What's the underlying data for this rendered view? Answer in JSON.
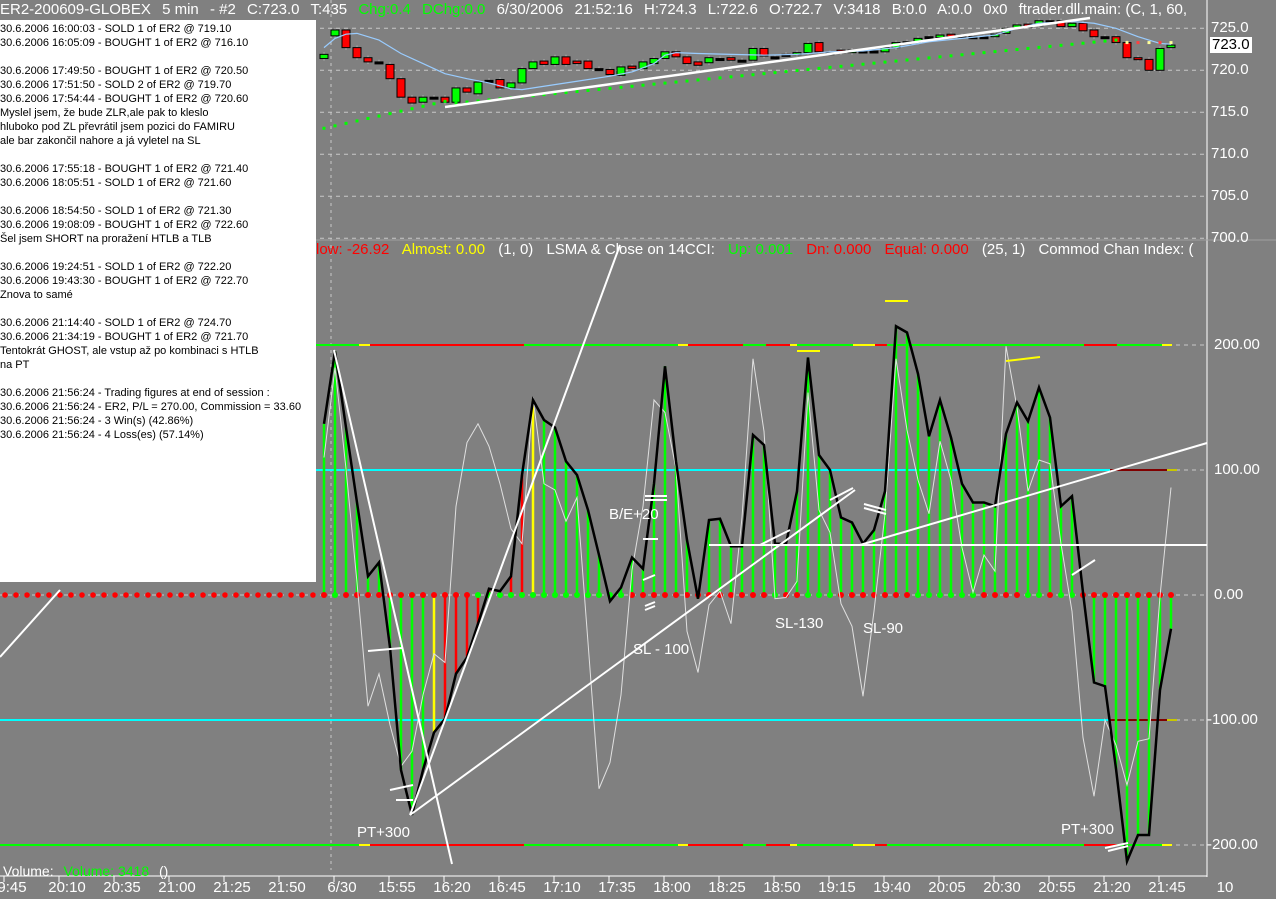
{
  "header": {
    "symbol": "ER2-200609-GLOBEX",
    "interval": "5 min",
    "chart_no": "- #2",
    "close": "C:723.0",
    "ticks": "T:435",
    "chg": "Chg:0.4",
    "dchg": "DChg:0.0",
    "date": "6/30/2006",
    "time": "21:52:16",
    "high": "H:724.3",
    "low": "L:722.6",
    "open": "O:722.7",
    "volume": "V:3418",
    "bid": "B:0.0",
    "ask": "A:0.0",
    "hex": "0x0",
    "study": "ftrader.dll.main:  (C, 1, 60,"
  },
  "trade_log": [
    "30.6.2006 16:00:03 - SOLD 1 of ER2 @ 719.10",
    "30.6.2006 16:05:09 - BOUGHT 1 of ER2 @ 716.10",
    "",
    "30.6.2006 17:49:50 - BOUGHT 1 of ER2 @ 720.50",
    "30.6.2006 17:51:50 - SOLD 2 of ER2 @ 719.70",
    "30.6.2006 17:54:44 - BOUGHT 1 of ER2 @ 720.60",
    "Myslel jsem, že bude ZLR,ale pak to kleslo",
    "hluboko pod ZL převrátil jsem pozici do FAMIRU",
    "ale bar zakončil nahore a já vyletel na SL",
    "",
    "30.6.2006 17:55:18 - BOUGHT 1 of ER2 @ 721.40",
    "30.6.2006 18:05:51 - SOLD 1 of ER2 @ 721.60",
    "",
    "30.6.2006 18:54:50 - SOLD 1 of ER2 @ 721.30",
    "30.6.2006 19:08:09 - BOUGHT 1 of ER2 @ 722.60",
    "Šel jsem SHORT na proražení HTLB a TLB",
    "",
    "30.6.2006 19:24:51 - SOLD 1 of ER2 @ 722.20",
    "30.6.2006 19:43:30 - BOUGHT 1 of ER2 @ 722.70",
    "Znova to samé",
    "",
    "30.6.2006 21:14:40 - SOLD 1 of ER2 @ 724.70",
    "30.6.2006 21:34:19 - BOUGHT 1 of ER2 @ 721.70",
    "Tentokrát GHOST, ale vstup až po kombinaci s HTLB",
    "na PT",
    "",
    "30.6.2006 21:56:24 - Trading figures at end of session :",
    "30.6.2006 21:56:24 - ER2, P/L = 270.00, Commission = 33.60",
    "30.6.2006 21:56:24 - 3 Win(s) (42.86%)",
    "30.6.2006 21:56:24 - 4 Loss(es) (57.14%)"
  ],
  "indicator_header": {
    "low": "low: -26.92",
    "almost": "Almost: 0.00",
    "params1": "(1, 0)",
    "lsma": "LSMA & Close on 14CCI:",
    "up": "Up: 0.001",
    "dn": "Dn: 0.000",
    "equal": "Equal: 0.000",
    "params2": "(25, 1)",
    "cci": "Commod Chan Index: ("
  },
  "annotations": {
    "be": "B/E+20",
    "sl100": "SL - 100",
    "sl130": "SL-130",
    "sl90": "SL-90",
    "pt_left": "PT+300",
    "pt_right": "PT+300"
  },
  "volume": {
    "label": "Volume:",
    "value": "Volume: 3418",
    "params": "()"
  },
  "colors": {
    "background": "#808080",
    "up_candle": "#00ff00",
    "down_candle": "#ff0000",
    "ma": "#99ccff",
    "cci_line": "#000000",
    "turbo_cci": "#e0e0e0",
    "level_100": "#00ffff",
    "level_200": "#00ff00"
  },
  "chart_data": {
    "type": "candlestick",
    "title": "ER2-200609-GLOBEX 5 min",
    "x_labels": [
      "9:45",
      "20:10",
      "20:35",
      "21:00",
      "21:25",
      "21:50",
      "6/30",
      "15:55",
      "16:20",
      "16:45",
      "17:10",
      "17:35",
      "18:00",
      "18:25",
      "18:50",
      "19:15",
      "19:40",
      "20:05",
      "20:30",
      "20:55",
      "21:20",
      "21:45",
      "10"
    ],
    "price_axis": {
      "ticks": [
        "725.0",
        "720.0",
        "715.0",
        "710.0",
        "705.0",
        "700.0"
      ],
      "tick_values": [
        725,
        720,
        715,
        710,
        705,
        700
      ],
      "range": [
        700,
        726.5
      ],
      "current": "723.0"
    },
    "candles_open_close": [
      [
        721.4,
        721.9
      ],
      [
        724.1,
        724.8
      ],
      [
        724.8,
        722.7
      ],
      [
        722.7,
        721.5
      ],
      [
        721.5,
        721.0
      ],
      [
        721.0,
        721.0
      ],
      [
        720.7,
        719.0
      ],
      [
        719.0,
        716.8
      ],
      [
        716.8,
        716.1
      ],
      [
        716.2,
        716.8
      ],
      [
        716.8,
        716.8
      ],
      [
        716.8,
        716.2
      ],
      [
        716.2,
        717.9
      ],
      [
        717.9,
        717.4
      ],
      [
        717.2,
        718.6
      ],
      [
        718.8,
        718.8
      ],
      [
        718.9,
        717.9
      ],
      [
        717.9,
        718.5
      ],
      [
        718.5,
        720.2
      ],
      [
        720.2,
        721.0
      ],
      [
        721.1,
        720.7
      ],
      [
        720.7,
        721.6
      ],
      [
        721.6,
        720.7
      ],
      [
        721.1,
        720.8
      ],
      [
        721.1,
        720.2
      ],
      [
        720.2,
        720.2
      ],
      [
        720.1,
        719.5
      ],
      [
        719.4,
        720.4
      ],
      [
        720.5,
        720.2
      ],
      [
        720.2,
        721.0
      ],
      [
        720.8,
        721.4
      ],
      [
        721.4,
        722.2
      ],
      [
        722.2,
        721.6
      ],
      [
        721.6,
        720.8
      ],
      [
        721.0,
        720.6
      ],
      [
        720.9,
        721.5
      ],
      [
        721.4,
        721.4
      ],
      [
        721.5,
        721.2
      ],
      [
        721.2,
        721.2
      ],
      [
        721.2,
        722.6
      ],
      [
        722.6,
        721.7
      ],
      [
        721.6,
        721.6
      ],
      [
        721.9,
        721.9
      ],
      [
        721.9,
        722.1
      ],
      [
        722.1,
        723.2
      ],
      [
        723.3,
        722.2
      ],
      [
        722.1,
        722.1
      ],
      [
        722.4,
        722.1
      ],
      [
        722.1,
        722.4
      ],
      [
        722.3,
        722.3
      ],
      [
        722.3,
        722.3
      ],
      [
        722.2,
        722.7
      ],
      [
        722.7,
        723.3
      ],
      [
        723.4,
        723.4
      ],
      [
        723.3,
        723.8
      ],
      [
        724.0,
        724.0
      ],
      [
        723.9,
        724.2
      ],
      [
        724.3,
        724.0
      ],
      [
        724.1,
        724.1
      ],
      [
        724.0,
        724.0
      ],
      [
        724.0,
        724.0
      ],
      [
        724.0,
        724.3
      ],
      [
        724.4,
        725.0
      ],
      [
        725.1,
        725.4
      ],
      [
        725.5,
        725.1
      ],
      [
        725.3,
        725.9
      ],
      [
        725.9,
        725.9
      ],
      [
        725.9,
        725.2
      ],
      [
        725.2,
        725.6
      ],
      [
        725.6,
        724.7
      ],
      [
        724.8,
        724.0
      ],
      [
        724.0,
        724.0
      ],
      [
        724.0,
        723.3
      ],
      [
        723.3,
        721.5
      ],
      [
        721.5,
        721.3
      ],
      [
        721.3,
        720.0
      ],
      [
        720.0,
        722.6
      ],
      [
        722.7,
        723.0
      ]
    ],
    "moving_average_points": [
      [
        0,
        722.7
      ],
      [
        1,
        723.8
      ],
      [
        2,
        724.3
      ],
      [
        3,
        724.4
      ],
      [
        5,
        723.6
      ],
      [
        7,
        722.0
      ],
      [
        9,
        720.8
      ],
      [
        11,
        719.6
      ],
      [
        13,
        719.0
      ],
      [
        15,
        718.5
      ],
      [
        17,
        717.8
      ],
      [
        18,
        717.7
      ],
      [
        20,
        718.1
      ],
      [
        23,
        718.7
      ],
      [
        26,
        719.3
      ],
      [
        28,
        719.8
      ],
      [
        30,
        720.8
      ],
      [
        31,
        721.8
      ],
      [
        32,
        722.1
      ],
      [
        34,
        722.0
      ],
      [
        37,
        721.9
      ],
      [
        40,
        721.8
      ],
      [
        43,
        721.9
      ],
      [
        46,
        722.2
      ],
      [
        49,
        722.3
      ],
      [
        52,
        722.7
      ],
      [
        55,
        723.4
      ],
      [
        58,
        723.8
      ],
      [
        61,
        724.2
      ],
      [
        63,
        725.0
      ],
      [
        65,
        725.6
      ],
      [
        68,
        725.8
      ],
      [
        70,
        725.6
      ],
      [
        72,
        725.0
      ],
      [
        74,
        724.0
      ],
      [
        76,
        723.2
      ],
      [
        77,
        723.1
      ]
    ],
    "sar_points": [
      [
        0,
        713.1
      ],
      [
        11,
        716.3
      ],
      [
        12,
        716.1
      ],
      [
        72,
        723.6
      ],
      [
        73,
        723.3
      ],
      [
        77,
        723.3
      ]
    ],
    "cci_axis": {
      "ticks": [
        "200.00",
        "100.00",
        "0.00",
        "-100.00",
        "-200.00"
      ],
      "tick_values": [
        200,
        100,
        0,
        -100,
        -200
      ]
    },
    "cci": [
      137,
      195,
      134,
      74,
      15,
      26,
      -42,
      -140,
      -176,
      -140,
      -110,
      -99,
      -63,
      -50,
      -23,
      5,
      3,
      15,
      96,
      156,
      140,
      134,
      107,
      96,
      68,
      32,
      -5,
      6,
      30,
      21,
      89,
      183,
      107,
      44,
      -3,
      60,
      61,
      39,
      39,
      128,
      120,
      41,
      41,
      83,
      190,
      112,
      100,
      62,
      58,
      41,
      52,
      83,
      215,
      210,
      177,
      127,
      156,
      126,
      89,
      74,
      74,
      71,
      129,
      154,
      139,
      166,
      142,
      71,
      79,
      2,
      -70,
      -73,
      -139,
      -213,
      -192,
      -192,
      -76,
      -27
    ],
    "turbo_cci": [
      110,
      182,
      101,
      10,
      -89,
      -63,
      -104,
      -137,
      -125,
      -80,
      -47,
      -54,
      71,
      122,
      137,
      119,
      89,
      53,
      41,
      158,
      89,
      84,
      59,
      78,
      -38,
      -155,
      -134,
      -80,
      20,
      71,
      156,
      146,
      101,
      -29,
      -62,
      -8,
      3,
      -23,
      62,
      189,
      131,
      -3,
      -2,
      11,
      162,
      68,
      50,
      -7,
      -25,
      -81,
      -13,
      65,
      189,
      132,
      92,
      65,
      123,
      92,
      38,
      2,
      32,
      19,
      199,
      150,
      83,
      108,
      105,
      41,
      -13,
      -114,
      -161,
      -100,
      -120,
      -152,
      -117,
      -115,
      -1,
      86
    ],
    "histogram_colors": "ggggggggggyrrrrrrrrygggggggggggggggggggggggggggggggggggggggggggggggggggggggggggggggggggggggggyrrr",
    "zero_dots": "rgrrrrrrrrrrrrggggggggggggggrrrrrrrrrrrrrgrrgggrrrrrrrggggggrrrrggrggrrrrrrrrrrg"
  }
}
